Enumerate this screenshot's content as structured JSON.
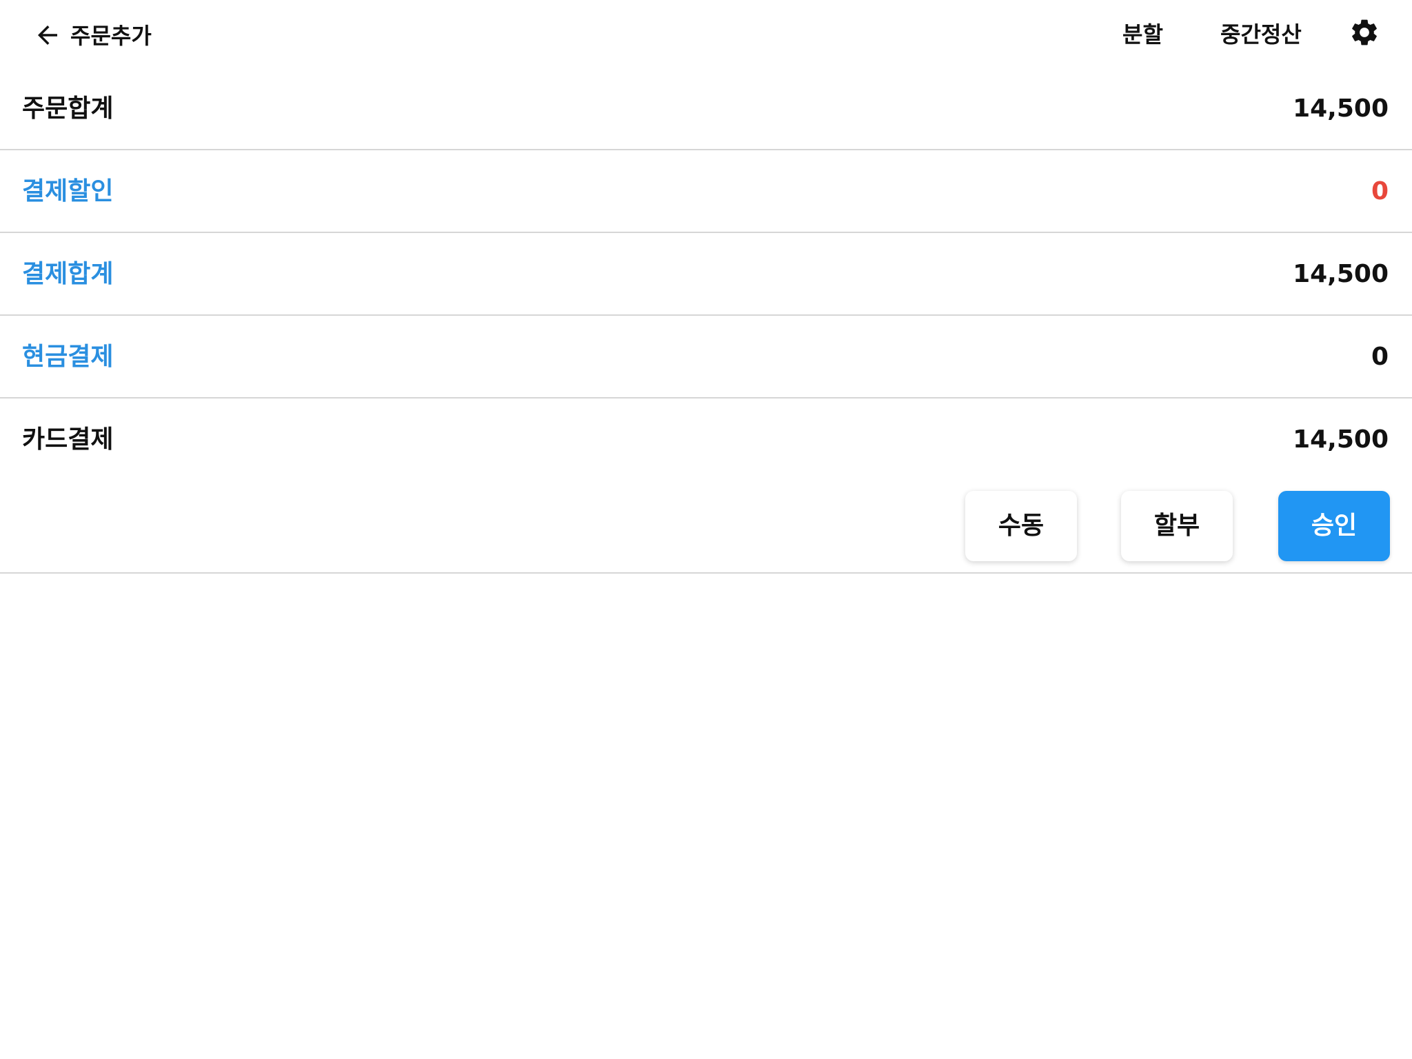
{
  "header": {
    "back_icon": "arrow-left-icon",
    "title": "주문추가",
    "actions": {
      "split": "분할",
      "interim_settlement": "중간정산"
    },
    "settings_icon": "gear-icon"
  },
  "summary": {
    "rows": [
      {
        "label": "주문합계",
        "value": "14,500"
      },
      {
        "label": "결제할인",
        "value": "0"
      },
      {
        "label": "결제합계",
        "value": "14,500"
      },
      {
        "label": "현금결제",
        "value": "0"
      },
      {
        "label": "카드결제",
        "value": "14,500"
      }
    ]
  },
  "card_buttons": {
    "manual": "수동",
    "installment": "할부",
    "approve": "승인"
  },
  "colors": {
    "accent_blue": "#2196f3",
    "label_blue": "#2a8fe0",
    "negative_red": "#e8473b",
    "text": "#111111",
    "divider": "#d6d6d6"
  }
}
